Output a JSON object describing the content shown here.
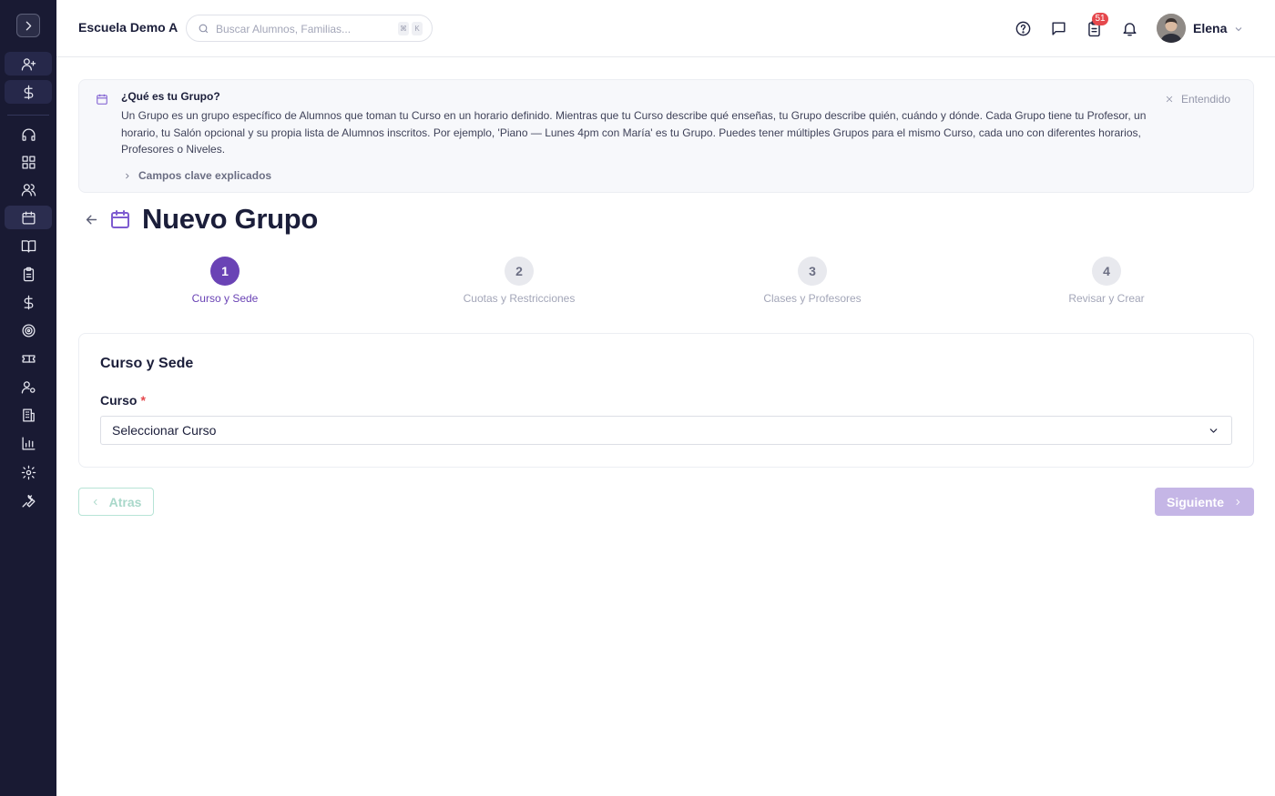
{
  "header": {
    "school_name": "Escuela Demo A",
    "search_placeholder": "Buscar Alumnos, Familias...",
    "shortcut_key_1": "⌘",
    "shortcut_key_2": "K",
    "tasks_badge": "51",
    "user_name": "Elena"
  },
  "sidebar": {
    "items": [
      {
        "icon": "user-plus-icon"
      },
      {
        "icon": "dollar-icon"
      },
      {
        "icon": "headset-icon"
      },
      {
        "icon": "dashboard-icon"
      },
      {
        "icon": "users-icon"
      },
      {
        "icon": "calendar-icon",
        "active": true
      },
      {
        "icon": "book-icon"
      },
      {
        "icon": "clipboard-icon"
      },
      {
        "icon": "dollar-icon"
      },
      {
        "icon": "target-icon"
      },
      {
        "icon": "ticket-icon"
      },
      {
        "icon": "user-gear-icon"
      },
      {
        "icon": "building-icon"
      },
      {
        "icon": "chart-icon"
      },
      {
        "icon": "gear-icon"
      },
      {
        "icon": "wrench-icon"
      }
    ]
  },
  "banner": {
    "title": "¿Qué es tu Grupo?",
    "text": "Un Grupo es un grupo específico de Alumnos que toman tu Curso en un horario definido. Mientras que tu Curso describe qué enseñas, tu Grupo describe quién, cuándo y dónde. Cada Grupo tiene tu Profesor, un horario, tu Salón opcional y su propia lista de Alumnos inscritos. Por ejemplo, 'Piano — Lunes 4pm con María' es tu Grupo. Puedes tener múltiples Grupos para el mismo Curso, cada uno con diferentes horarios, Profesores o Niveles.",
    "dismiss_label": "Entendido",
    "expand_label": "Campos clave explicados"
  },
  "page": {
    "title": "Nuevo Grupo"
  },
  "stepper": {
    "steps": [
      {
        "number": "1",
        "label": "Curso y Sede",
        "active": true
      },
      {
        "number": "2",
        "label": "Cuotas y Restricciones",
        "active": false
      },
      {
        "number": "3",
        "label": "Clases y Profesores",
        "active": false
      },
      {
        "number": "4",
        "label": "Revisar y Crear",
        "active": false
      }
    ]
  },
  "form": {
    "section_title": "Curso y Sede",
    "course_label": "Curso",
    "required_mark": "*",
    "course_value": "Seleccionar Curso"
  },
  "actions": {
    "back_label": "Atras",
    "next_label": "Siguiente"
  },
  "colors": {
    "sidebar_bg": "#191a33",
    "accent": "#6a43b5",
    "badge": "#e5484d"
  }
}
